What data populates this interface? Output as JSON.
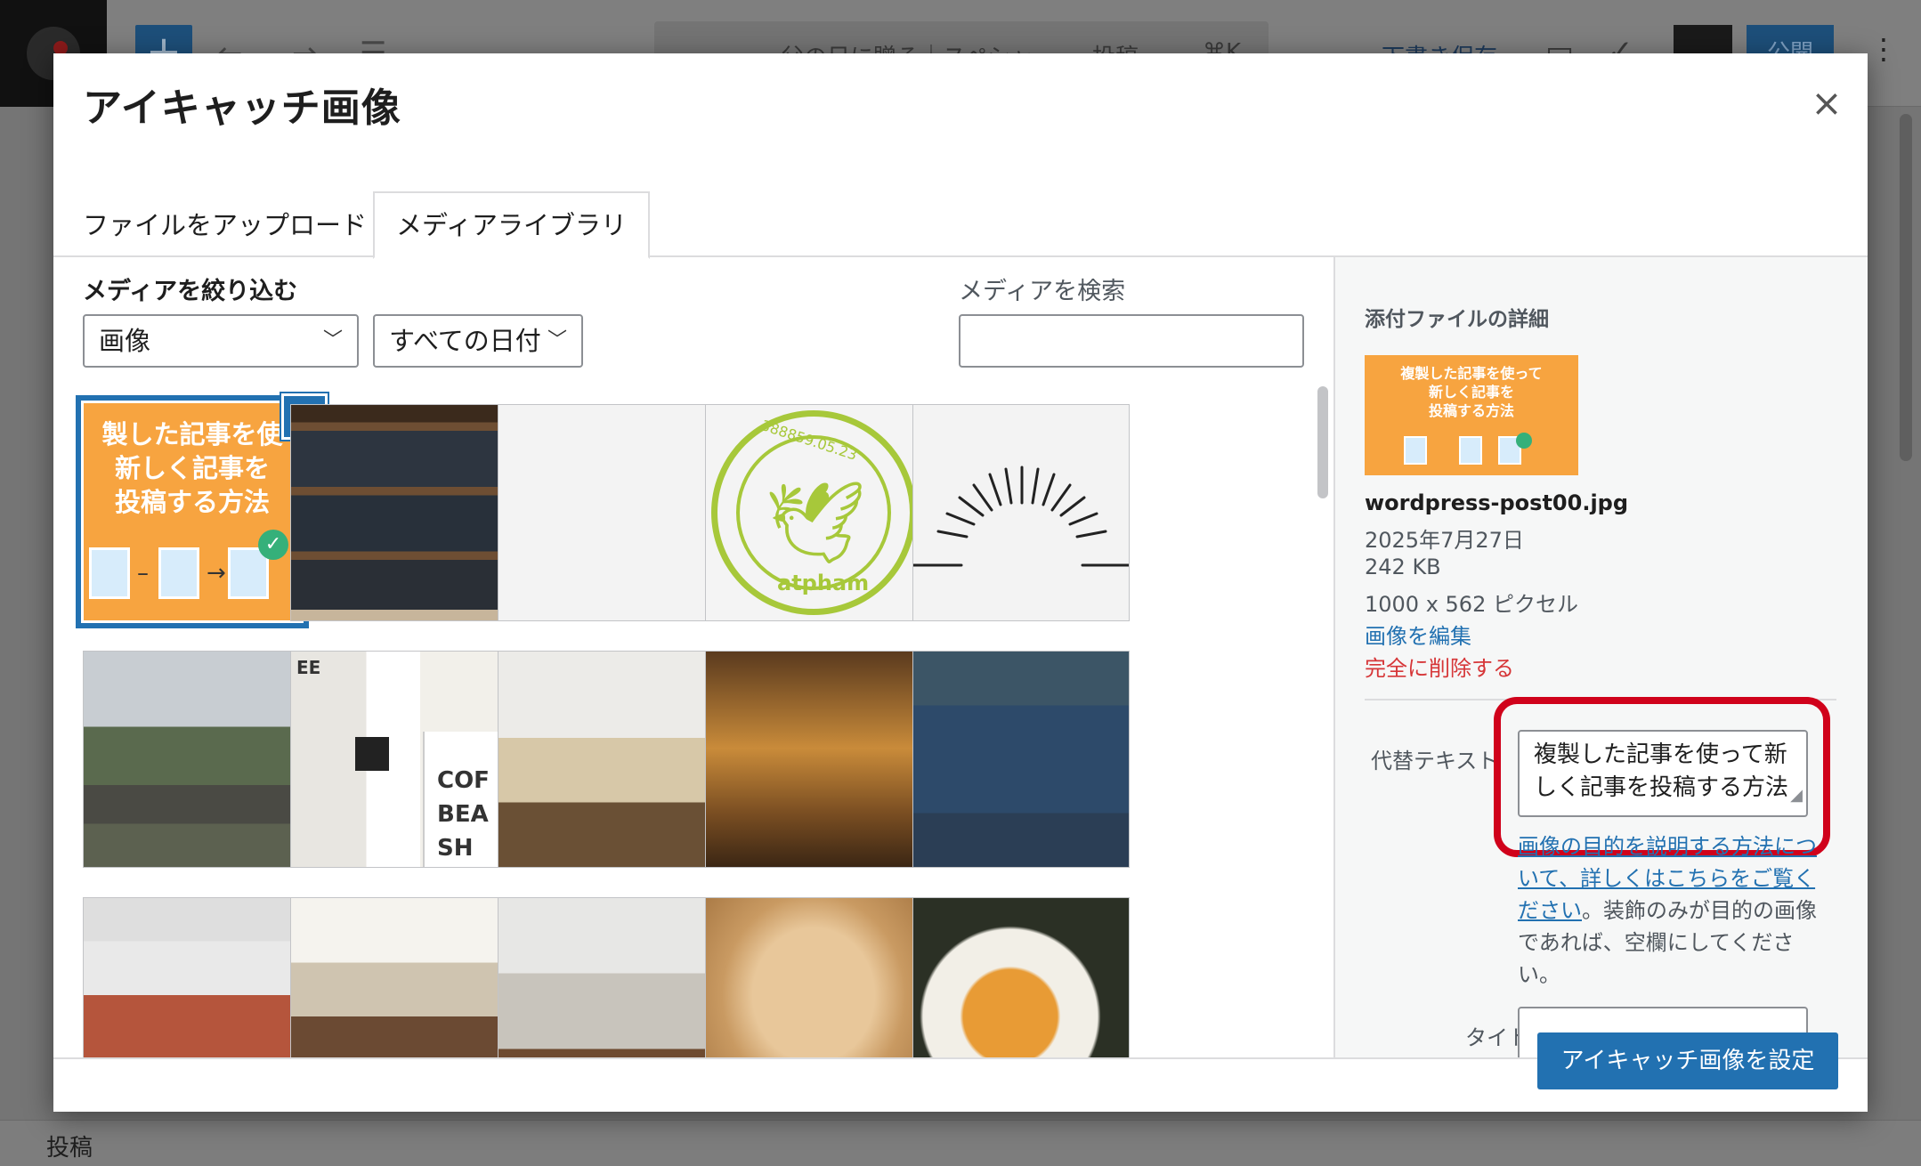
{
  "editor": {
    "doc_title_partial": "父の日に贈る｜スペシャ",
    "post_type": "投稿",
    "shortcut": "⌘K",
    "save_draft": "下書き保存",
    "publish": "公開",
    "footer_label": "投稿"
  },
  "modal": {
    "title": "アイキャッチ画像",
    "close_glyph": "×",
    "tabs": [
      {
        "label": "ファイルをアップロード",
        "active": false
      },
      {
        "label": "メディアライブラリ",
        "active": true
      }
    ]
  },
  "filters": {
    "heading": "メディアを絞り込む",
    "type_selected": "画像",
    "date_selected": "すべての日付",
    "search_label": "メディアを検索",
    "search_value": ""
  },
  "thumb_text": {
    "featured": "製した記事を使\n新しく記事を\n投稿する方法",
    "stamp_word": "atpham",
    "stamp_number": "388859.05.23",
    "cafe_letters": [
      "COF",
      "BEA",
      "SH"
    ],
    "cafe_sign": "EE"
  },
  "media_items": [
    {
      "name": "wordpress-post00",
      "selected": true
    },
    {
      "name": "coffee-shelf"
    },
    {
      "name": "blank-image"
    },
    {
      "name": "bird-stamp"
    },
    {
      "name": "sunburst"
    },
    {
      "name": "street-view"
    },
    {
      "name": "coffee-beans-shop"
    },
    {
      "name": "cafe-interior"
    },
    {
      "name": "bar-shelves"
    },
    {
      "name": "storefront"
    },
    {
      "name": "packaged-goods"
    },
    {
      "name": "bunting-jars"
    },
    {
      "name": "glass-jars"
    },
    {
      "name": "bread"
    },
    {
      "name": "food-plate"
    }
  ],
  "details": {
    "heading": "添付ファイルの詳細",
    "thumb_text": "複製した記事を使って\n新しく記事を\n投稿する方法",
    "filename": "wordpress-post00.jpg",
    "date": "2025年7月27日",
    "size": "242 KB",
    "dimensions": "1000 x 562 ピクセル",
    "edit_link": "画像を編集",
    "delete_link": "完全に削除する",
    "alt_label": "代替テキスト",
    "alt_value": "複製した記事を使って新しく記事を投稿する方法",
    "help_link": "画像の目的を説明する方法について、詳しくはこちらをご覧ください",
    "help_rest": "。装飾のみが目的の画像であれば、空欄にしてください。",
    "title_label": "タイトル",
    "title_value": ""
  },
  "toolbar": {
    "set_button": "アイキャッチ画像を設定"
  },
  "colors": {
    "accent": "#2271b1",
    "danger": "#d63638",
    "highlight": "#d0021b",
    "thumb_orange": "#f7a440"
  }
}
